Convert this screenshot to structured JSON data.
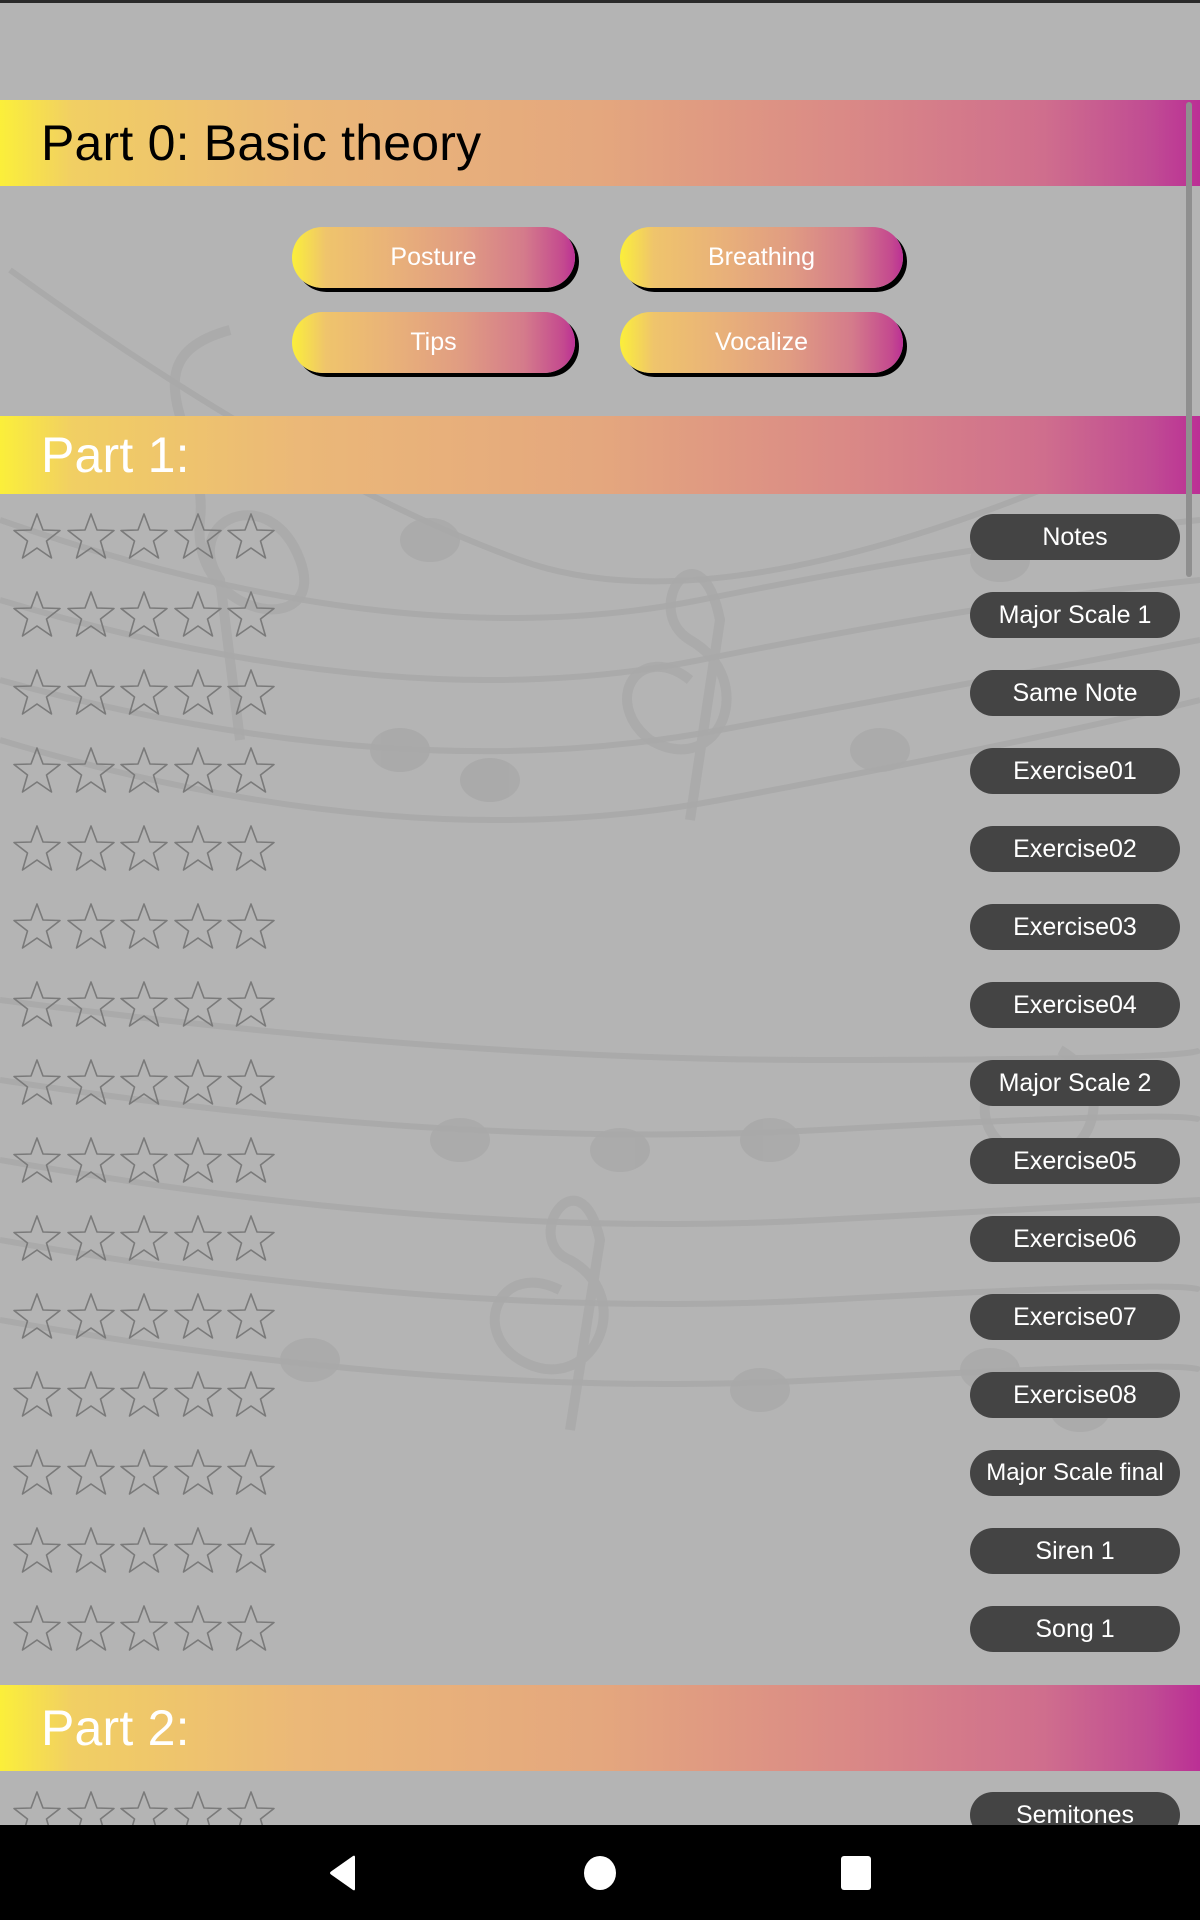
{
  "sections": {
    "part0": {
      "title": "Part 0: Basic theory",
      "buttons": [
        {
          "label": "Posture"
        },
        {
          "label": "Breathing"
        },
        {
          "label": "Tips"
        },
        {
          "label": "Vocalize"
        }
      ]
    },
    "part1": {
      "title": "Part 1:",
      "lessons": [
        {
          "label": "Notes",
          "rating": 0,
          "max_rating": 5
        },
        {
          "label": "Major Scale 1",
          "rating": 0,
          "max_rating": 5
        },
        {
          "label": "Same Note",
          "rating": 0,
          "max_rating": 5
        },
        {
          "label": "Exercise01",
          "rating": 0,
          "max_rating": 5
        },
        {
          "label": "Exercise02",
          "rating": 0,
          "max_rating": 5
        },
        {
          "label": "Exercise03",
          "rating": 0,
          "max_rating": 5
        },
        {
          "label": "Exercise04",
          "rating": 0,
          "max_rating": 5
        },
        {
          "label": "Major Scale 2",
          "rating": 0,
          "max_rating": 5
        },
        {
          "label": "Exercise05",
          "rating": 0,
          "max_rating": 5
        },
        {
          "label": "Exercise06",
          "rating": 0,
          "max_rating": 5
        },
        {
          "label": "Exercise07",
          "rating": 0,
          "max_rating": 5
        },
        {
          "label": "Exercise08",
          "rating": 0,
          "max_rating": 5
        },
        {
          "label": "Major Scale final",
          "rating": 0,
          "max_rating": 5
        },
        {
          "label": "Siren 1",
          "rating": 0,
          "max_rating": 5
        },
        {
          "label": "Song 1",
          "rating": 0,
          "max_rating": 5
        }
      ]
    },
    "part2": {
      "title": "Part 2:",
      "lessons": [
        {
          "label": "Semitones",
          "rating": 0,
          "max_rating": 5
        }
      ]
    }
  },
  "icons": {
    "star": "star-outline-icon",
    "back": "back-triangle-icon",
    "home": "home-circle-icon",
    "recents": "recents-square-icon"
  },
  "colors": {
    "background": "#b4b4b4",
    "gradient_start": "#fbef3a",
    "gradient_mid": "#e4a77e",
    "gradient_end": "#bb2f95",
    "pill": "#444444",
    "star_outline": "#7a7a7a",
    "navbar": "#000000"
  }
}
